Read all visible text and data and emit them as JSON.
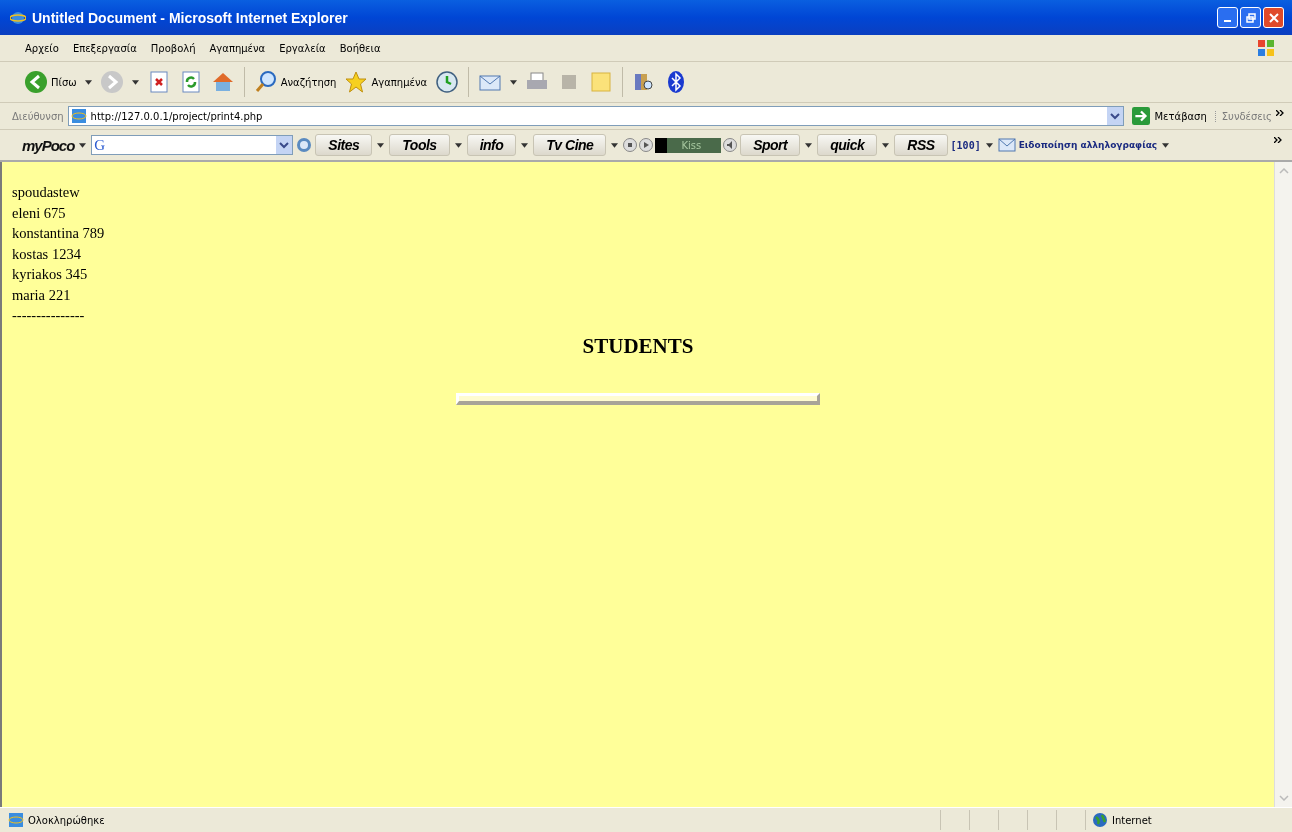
{
  "window": {
    "title": "Untitled Document - Microsoft Internet Explorer"
  },
  "menu": [
    "Αρχείο",
    "Επεξεργασία",
    "Προβολή",
    "Αγαπημένα",
    "Εργαλεία",
    "Βοήθεια"
  ],
  "toolbar": [
    {
      "kind": "back",
      "label": "Πίσω"
    },
    {
      "kind": "forward"
    },
    {
      "kind": "stop"
    },
    {
      "kind": "refresh"
    },
    {
      "kind": "home"
    },
    {
      "kind": "search",
      "label": "Αναζήτηση"
    },
    {
      "kind": "favorites",
      "label": "Αγαπημένα"
    },
    {
      "kind": "history"
    },
    {
      "kind": "mail"
    },
    {
      "kind": "print"
    },
    {
      "kind": "edit"
    },
    {
      "kind": "note"
    },
    {
      "kind": "research"
    },
    {
      "kind": "bluetooth"
    }
  ],
  "address": {
    "label": "Διεύθυνση",
    "url": "http://127.0.0.1/project/print4.php",
    "go": "Μετάβαση",
    "links": "Συνδέσεις"
  },
  "toolbar2": {
    "brand": "myPoco",
    "search_engine": "G",
    "buttons": [
      {
        "label": "Sites"
      },
      {
        "label": "Tools"
      },
      {
        "label": "info"
      },
      {
        "label": "Tv Cine"
      }
    ],
    "player": "Kiss",
    "buttons2": [
      {
        "label": "Sport"
      },
      {
        "label": "quick"
      },
      {
        "label": "RSS"
      }
    ],
    "count": "[100]",
    "mail": "Ειδοποίηση αλληλογραφίας"
  },
  "page": {
    "lines": [
      "spoudastew",
      "eleni 675",
      "konstantina 789",
      "kostas 1234",
      "kyriakos 345",
      "maria 221",
      "---------------"
    ],
    "heading": "STUDENTS"
  },
  "status": {
    "text": "Ολοκληρώθηκε",
    "zone": "Internet"
  }
}
